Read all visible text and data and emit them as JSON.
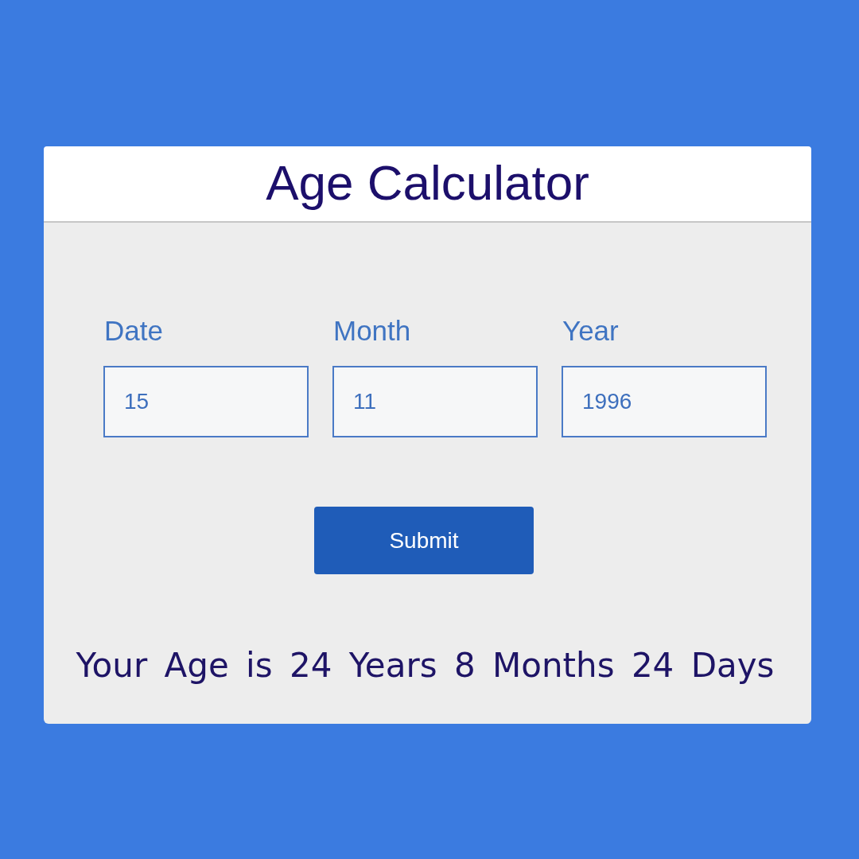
{
  "header": {
    "title": "Age Calculator"
  },
  "fields": [
    {
      "label": "Date",
      "value": "15"
    },
    {
      "label": "Month",
      "value": "11"
    },
    {
      "label": "Year",
      "value": "1996"
    }
  ],
  "submit_button": {
    "label": "Submit"
  },
  "result": "Your Age is 24 Years 8 Months 24 Days"
}
